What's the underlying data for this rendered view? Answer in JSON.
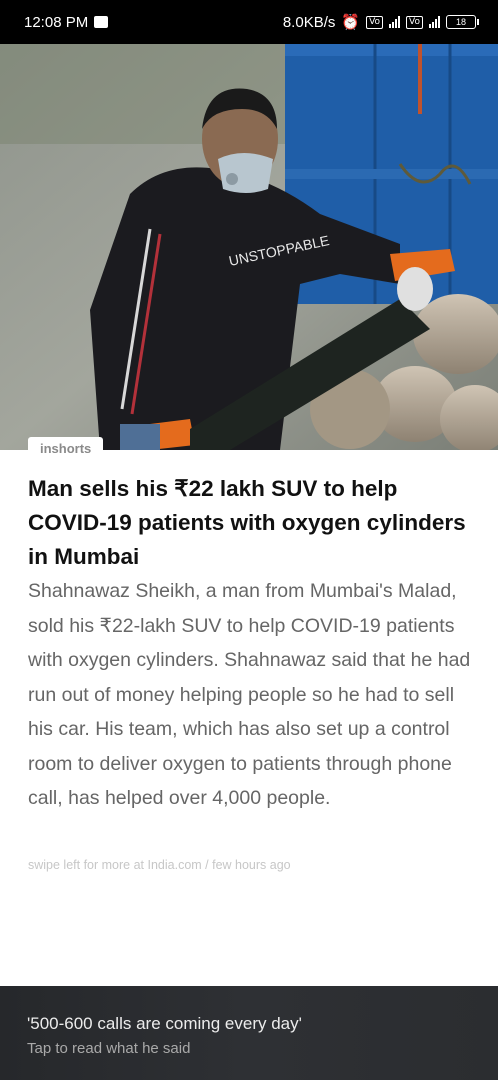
{
  "status_bar": {
    "time": "12:08 PM",
    "network_speed": "8.0KB/s",
    "battery_level": "18",
    "icons": [
      "notification-icon",
      "alarm-icon",
      "volte-icon",
      "signal-icon",
      "4g-icon",
      "battery-icon"
    ]
  },
  "article": {
    "source": "inshorts",
    "headline": "Man sells his ₹22 lakh SUV to help COVID-19 patients with oxygen cylinders in Mumbai",
    "body": "Shahnawaz Sheikh, a man from Mumbai's Malad, sold his ₹22-lakh SUV to help COVID-19 patients with oxygen cylinders. Shahnawaz said that he had run out of money helping people so he had to sell his car. His team, which has also set up a control room to deliver oxygen to patients through phone call, has helped over 4,000 people.",
    "byline": "swipe left for more at India.com / few hours ago"
  },
  "footer": {
    "title": "'500-600 calls are coming every day'",
    "subtitle": "Tap to read what he said"
  }
}
